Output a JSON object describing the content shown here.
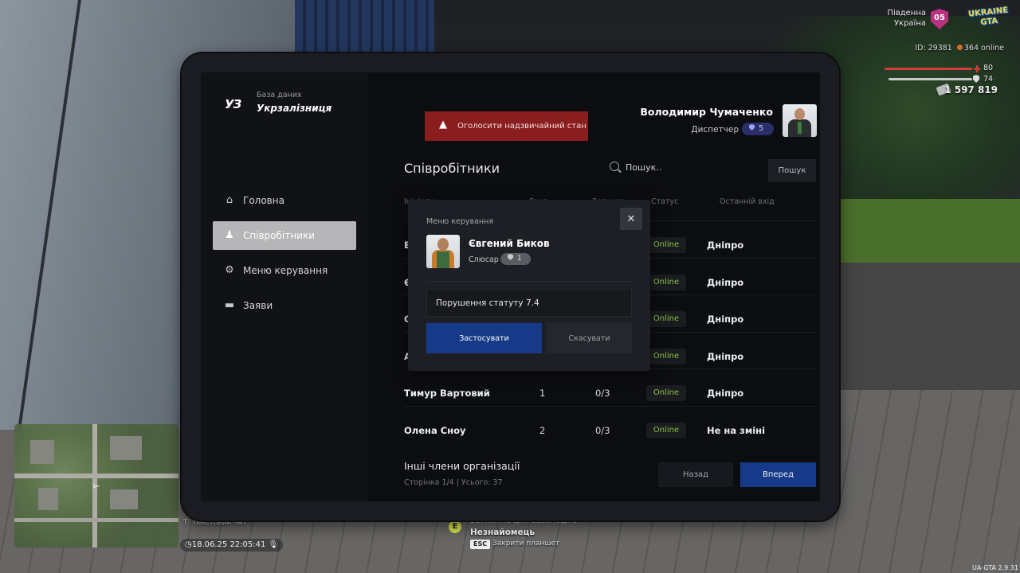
{
  "hud": {
    "region_line1": "Південна",
    "region_line2": "Україна",
    "region_badge": "05",
    "game_logo": "UKRAINE GTA",
    "server_id": "ID: 29381",
    "online": "364 online",
    "health": "80",
    "armor": "74",
    "money": "1 597 819",
    "health_color": "#d13d3d"
  },
  "chat": {
    "line1": "Я",
    "line2": "Т",
    "placeholder": "Текстовий чат",
    "datetime": "18.06.25 22:05:41"
  },
  "interaction": {
    "key": "E",
    "hint": "Затисніть для взаємодії з",
    "target": "Незнайомець",
    "esc_key": "ESC",
    "esc_label": "Закрити планшет"
  },
  "version": "UA-GTA 2.9   31",
  "tablet": {
    "app": {
      "logo_mark": "УЗ",
      "subtitle": "База даних",
      "title": "Укрзалізниця"
    },
    "alert_button": "Оголосити надзвичайний стан",
    "user": {
      "name": "Володимир Чумаченко",
      "role": "Диспетчер",
      "rank": "5"
    },
    "sidebar": {
      "items": [
        {
          "label": "Головна",
          "icon": "home-icon"
        },
        {
          "label": "Співробітники",
          "icon": "people-icon",
          "active": true
        },
        {
          "label": "Меню керування",
          "icon": "gear-icon"
        },
        {
          "label": "Заяви",
          "icon": "folder-icon"
        }
      ]
    },
    "employees": {
      "title": "Співробітники",
      "search_placeholder": "Пошук..",
      "search_button": "Пошук",
      "columns": [
        "Ініціали",
        "Ранг",
        "Доганки",
        "Статус",
        "Останній вхід"
      ],
      "rows": [
        {
          "name": "Е",
          "rank": "",
          "warnings": "",
          "status": "Online",
          "last": "Дніпро"
        },
        {
          "name": "Є",
          "rank": "",
          "warnings": "",
          "status": "Online",
          "last": "Дніпро"
        },
        {
          "name": "С",
          "rank": "",
          "warnings": "",
          "status": "Online",
          "last": "Дніпро"
        },
        {
          "name": "А",
          "rank": "",
          "warnings": "",
          "status": "Online",
          "last": "Дніпро"
        },
        {
          "name": "Тимур Вартовий",
          "rank": "1",
          "warnings": "0/3",
          "status": "Online",
          "last": "Дніпро"
        },
        {
          "name": "Олена Сноу",
          "rank": "2",
          "warnings": "0/3",
          "status": "Online",
          "last": "Не на зміні"
        }
      ],
      "others_title": "Інші члени організації",
      "pager": "Сторінка 1/4 | Усього: 37",
      "back": "Назад",
      "next": "Вперед"
    },
    "dialog": {
      "label": "Меню керування",
      "close": "✕",
      "name": "Євгений Биков",
      "role": "Слюсар",
      "rank": "1",
      "reason": "Порушення статуту 7.4",
      "apply": "Застосувати",
      "cancel": "Скасувати"
    }
  }
}
